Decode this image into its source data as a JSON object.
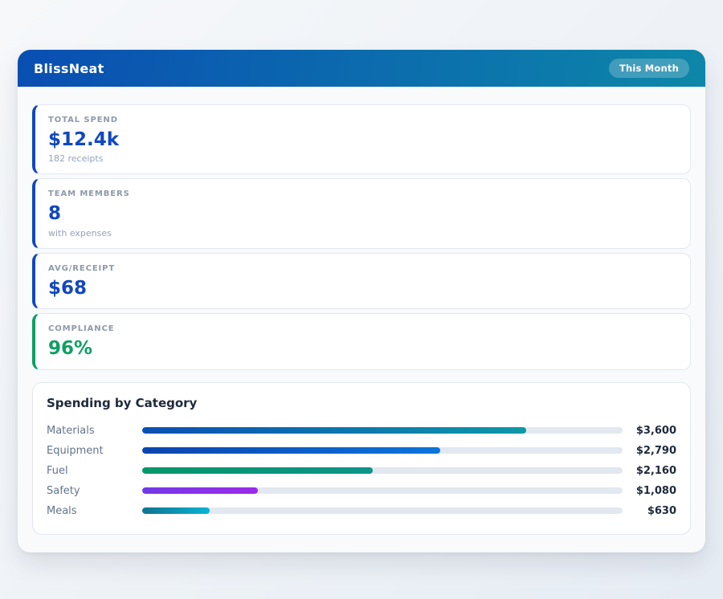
{
  "header": {
    "title": "BlissNeat",
    "badge": "This Month"
  },
  "stats": [
    {
      "label": "TOTAL SPEND",
      "value": "$12.4k",
      "sub": "182 receipts",
      "accent": "#1148c0"
    },
    {
      "label": "TEAM MEMBERS",
      "value": "8",
      "sub": "with expenses",
      "accent": "#1148c0"
    },
    {
      "label": "AVG/RECEIPT",
      "value": "$68",
      "sub": "",
      "accent": "#1148c0"
    },
    {
      "label": "COMPLIANCE",
      "value": "96%",
      "sub": "",
      "accent": "#0f9f63"
    }
  ],
  "chart_data": {
    "type": "bar",
    "orientation": "horizontal",
    "title": "Spending by Category",
    "categories": [
      "Materials",
      "Equipment",
      "Fuel",
      "Safety",
      "Meals"
    ],
    "values": [
      3600,
      2790,
      2160,
      1080,
      630
    ],
    "value_labels": [
      "$3,600",
      "$2,790",
      "$2,160",
      "$1,080",
      "$630"
    ],
    "scale_max": 4500,
    "track_color": "#e2e8f0",
    "bar_gradients": [
      [
        "#0a4fb4",
        "#0d98a8"
      ],
      [
        "#0a44ae",
        "#0b74dc"
      ],
      [
        "#059669",
        "#0d9488"
      ],
      [
        "#7438e8",
        "#9c2ae8"
      ],
      [
        "#0e7490",
        "#08b4d4"
      ]
    ]
  },
  "colors": {
    "header_gradient_start": "#0a4eb2",
    "header_gradient_end": "#0d87a9",
    "stat_value_blue": "#1148c0",
    "compliance_green": "#0f9f63",
    "panel_background": "#ffffff",
    "container_background": "#f8fafc"
  }
}
